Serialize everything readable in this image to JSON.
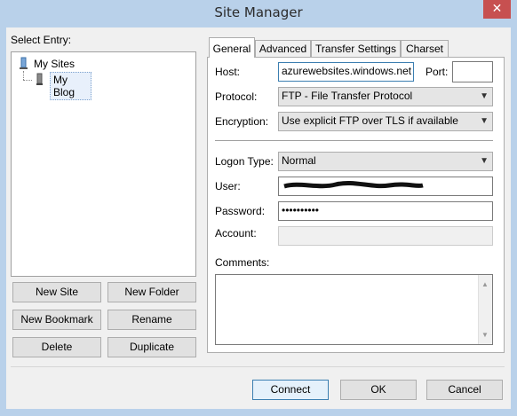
{
  "window": {
    "title": "Site Manager",
    "close_glyph": "✕"
  },
  "select_entry_label": "Select Entry:",
  "tree": {
    "root_label": "My Sites",
    "child_label": "My Blog"
  },
  "left_buttons": {
    "new_site": "New Site",
    "new_folder": "New Folder",
    "new_bookmark": "New Bookmark",
    "rename": "Rename",
    "delete": "Delete",
    "duplicate": "Duplicate"
  },
  "tabs": [
    "General",
    "Advanced",
    "Transfer Settings",
    "Charset"
  ],
  "general": {
    "host_label": "Host:",
    "host_value": "azurewebsites.windows.net",
    "port_label": "Port:",
    "port_value": "",
    "protocol_label": "Protocol:",
    "protocol_value": "FTP - File Transfer Protocol",
    "encryption_label": "Encryption:",
    "encryption_value": "Use explicit FTP over TLS if available",
    "logon_type_label": "Logon Type:",
    "logon_type_value": "Normal",
    "user_label": "User:",
    "password_label": "Password:",
    "password_value": "••••••••••",
    "account_label": "Account:",
    "comments_label": "Comments:"
  },
  "bottom_buttons": {
    "connect": "Connect",
    "ok": "OK",
    "cancel": "Cancel"
  },
  "icons": {
    "close": "close-icon",
    "root_folder": "server-folder-icon",
    "site": "site-icon",
    "dropdown": "chevron-down-icon"
  }
}
